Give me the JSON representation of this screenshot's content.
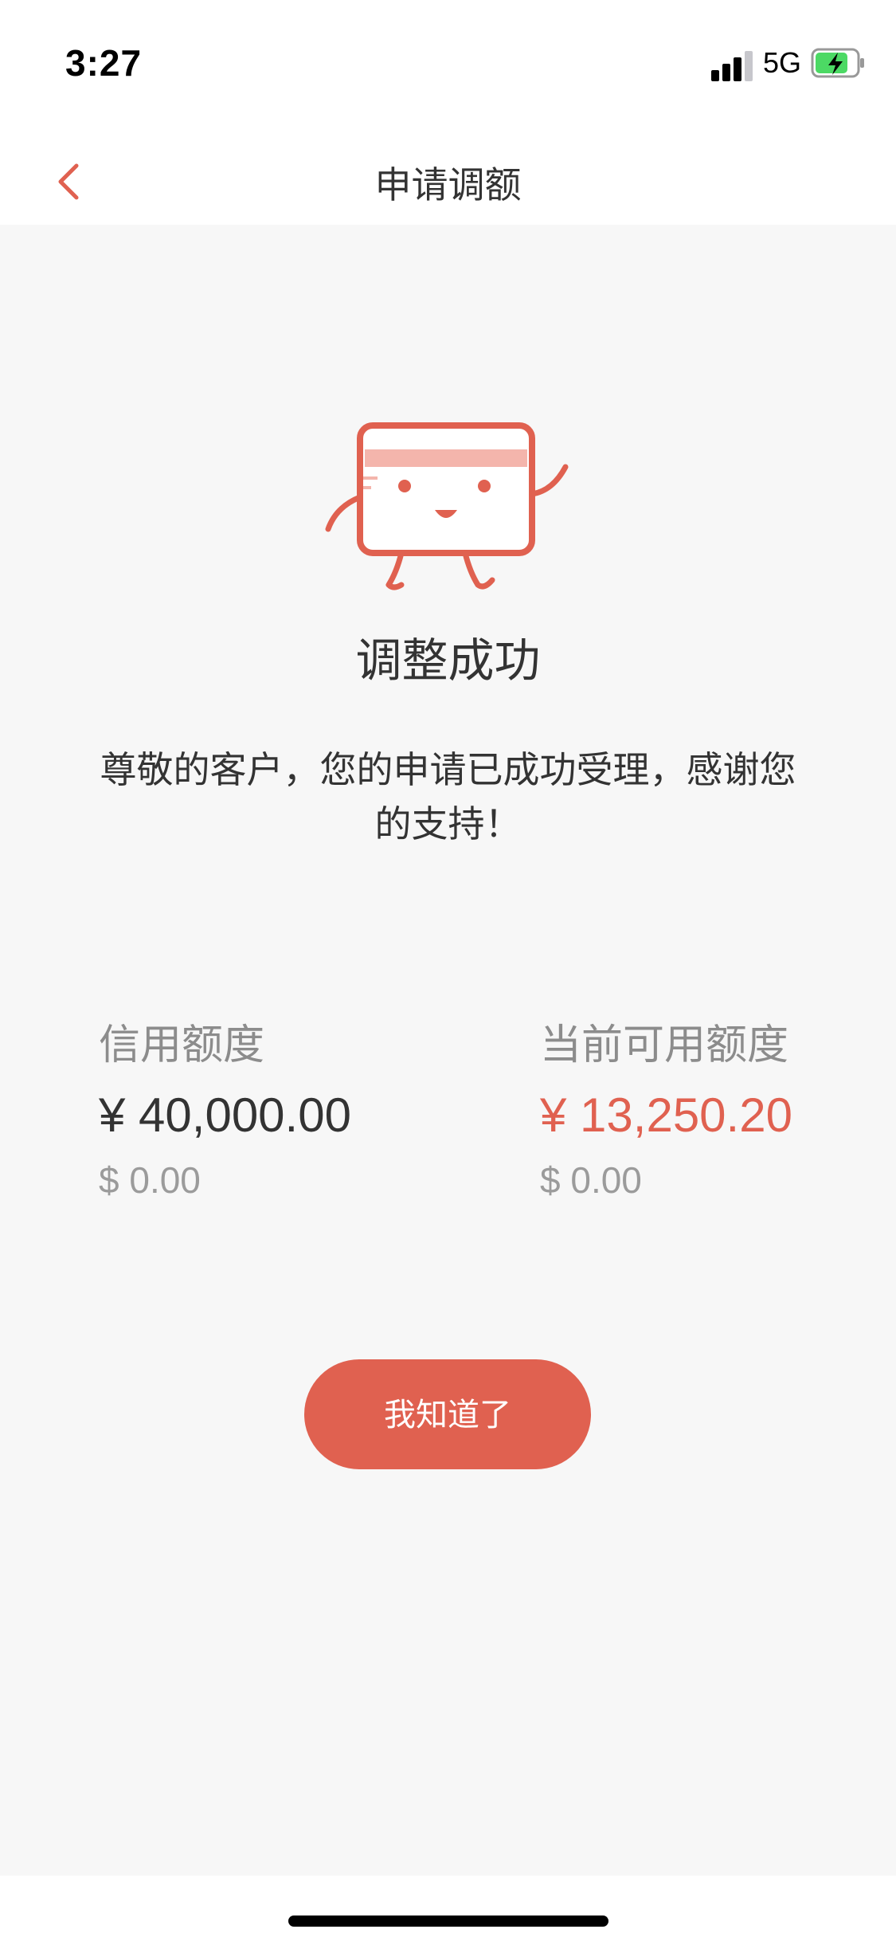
{
  "status_bar": {
    "time": "3:27",
    "network": "5G",
    "battery_state": "charging",
    "battery_color": "#4cd964"
  },
  "nav": {
    "back_icon": "chevron-left-icon",
    "title": "申请调额"
  },
  "result": {
    "illustration": "card-mascot-icon",
    "title": "调整成功",
    "message": "尊敬的客户，您的申请已成功受理，感谢您的支持！"
  },
  "limits": {
    "credit_limit": {
      "label": "信用额度",
      "cny": "¥ 40,000.00",
      "usd": "$ 0.00"
    },
    "available_limit": {
      "label": "当前可用额度",
      "cny": "¥ 13,250.20",
      "usd": "$ 0.00"
    }
  },
  "actions": {
    "confirm_label": "我知道了"
  },
  "colors": {
    "accent": "#e06150",
    "background": "#f7f7f7",
    "text_primary": "#333333",
    "text_secondary": "#8c8c8c"
  }
}
